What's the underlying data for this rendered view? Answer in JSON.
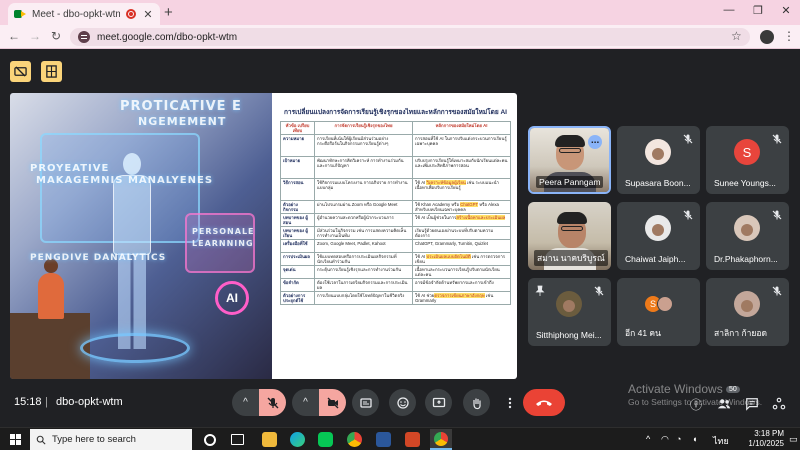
{
  "browser": {
    "tab_title": "Meet - dbo-opkt-wtm",
    "tab_close": "✕",
    "new_tab": "+",
    "url": "meet.google.com/dbo-opkt-wtm",
    "window_controls": [
      "—",
      "❐",
      "✕"
    ]
  },
  "slide": {
    "art_title": "PROTICATIVE E",
    "art_subtitle": "NGEMEMENT",
    "art_left_line1": "PROYEATIVE",
    "art_left_line2": "MAKAGEMNIS MANALYENES",
    "art_personal1": "PERSONALE",
    "art_personal2": "LEARNNING",
    "art_danalytics": "PENGDIVE DANALYTICS",
    "art_ai": "AI",
    "title": "การเปลี่ยนแปลงการจัดการเรียนรู้เชิงรุกของไทยและหลักการของสมัยใหม่โดย AI",
    "headers": [
      "หัวข้อ เปรียบเทียบ",
      "การจัดการเรียนรู้เชิงรุกของไทย",
      "หลักการของสมัยใหม่โดย AI"
    ],
    "rows": [
      {
        "aspect": "ความหมาย",
        "thai": "การเรียนที่เน้นให้ผู้เรียนมีส่วนร่วมอย่างกระตือรือร้นในกิจกรรมการเรียนรู้ต่างๆ",
        "ai": "การสอนที่ใช้ AI ในการปรับแต่งกระบวนการเรียนรู้เฉพาะบุคคล"
      },
      {
        "aspect": "เป้าหมาย",
        "thai": "พัฒนาทักษะการคิดวิเคราะห์ การทำงานร่วมกัน และการแก้ปัญหา",
        "ai": "ปรับปรุงการเรียนรู้ให้เหมาะสมกับนักเรียนแต่ละคน และเพิ่มประสิทธิภาพการสอน"
      },
      {
        "aspect": "วิธีการสอน",
        "thai": "ใช้กิจกรรมแบบโครงงาน การอภิปราย การทำงานแบบกลุ่ม",
        "ai_pre": "ใช้ AI ",
        "ai_hl": "วิเคราะห์ข้อมูลผู้เรียน",
        "ai_post": " เช่น ระบบแนะนำเนื้อหาเพื่อปรับการเรียนรู้"
      },
      {
        "aspect": "ตัวอย่าง กิจกรรม",
        "thai": "ผ่านโปรแกรมผ่าน Zoom หรือ Google Meet",
        "ai_pre": "ใช้ Khan Academy หรือ ",
        "ai_hl": "ChatGPT",
        "ai_post": " หรือ Alexa สำหรับบทเรียนเฉพาะบุคคล"
      },
      {
        "aspect": "บทบาทของ ผู้สอน",
        "thai": "ผู้อำนวยความสะดวกหรือผู้นำกระบวนการ",
        "ai_pre": "ใช้ AI เป็นผู้ช่วยในการ",
        "ai_hl": "สร้างเนื้อหาและประเมินผล",
        "ai_post": ""
      },
      {
        "aspect": "บทบาทของ ผู้เรียน",
        "thai": "มีส่วนร่วมในกิจกรรม เช่น การแสดงความคิดเห็น การทำงานเป็นทีม",
        "ai": "เรียนรู้ด้วยตนเองผ่านระบบที่ปรับตามความต้องการ"
      },
      {
        "aspect": "เครื่องมือที่ใช้",
        "thai": "Zoom, Google Meet, Padlet, Kahoot",
        "ai": "ChatGPT, Grammarly, Turnitin, Quizlet"
      },
      {
        "aspect": "การประเมินผล",
        "thai": "ใช้แบบทดสอบหรือการประเมินผลกิจกรรมที่นักเรียนทำร่วมกัน",
        "ai_pre": "ใช้ AI ",
        "ai_hl": "ประเมินผลแบบอัตโนมัติ",
        "ai_post": " เช่น การตรวจการเขียน"
      },
      {
        "aspect": "จุดเด่น",
        "thai": "กระตุ้นการเรียนรู้เชิงรุกและการทำงานร่วมกัน",
        "ai": "เนื้อหาและกระบวนการเรียนรู้ปรับตามนักเรียนแต่ละคน"
      },
      {
        "aspect": "ข้อจำกัด",
        "thai": "ต้องใช้เวลาในการเตรียมกิจกรรมและการประเมินผล",
        "ai": "อาจมีข้อจำกัดด้านทรัพยากรและการเข้าถึง"
      },
      {
        "aspect": "ตัวอย่างการ ประยุกต์ใช้",
        "thai": "การเรียนแบบกลุ่มโดยใช้โจทย์ปัญหาในชีวิตจริง",
        "ai_pre": "ใช้ AI ช่วย",
        "ai_hl": "ตรวจการเขียนภาษาอังกฤษ",
        "ai_post": " เช่น Grammarly"
      }
    ]
  },
  "participants": [
    {
      "name": "Peera Panngam",
      "type": "video",
      "active": true
    },
    {
      "name": "Supasara Boon...",
      "type": "avatar",
      "color": "#f3e6df"
    },
    {
      "name": "Sunee Youngs...",
      "type": "letter",
      "letter": "S",
      "color": "#e8453c"
    },
    {
      "name": "สมาน นาคบริบูรณ์",
      "type": "video2"
    },
    {
      "name": "Chaiwat Jaiph...",
      "type": "avatar",
      "color": "#e9e9e9"
    },
    {
      "name": "Dr.Phakaphorn...",
      "type": "avatar",
      "color": "#d9c7ba"
    },
    {
      "name": "Sitthiphong Mei...",
      "type": "avatar",
      "color": "#6b5c3e"
    },
    {
      "name": "อีก 41 คน",
      "type": "more",
      "letter": "S"
    },
    {
      "name": "สาลิกา ก้ายอด",
      "type": "avatar",
      "color": "#c3a79a"
    }
  ],
  "meeting": {
    "time": "15:18",
    "separator": "|",
    "code": "dbo-opkt-wtm",
    "participants_badge": "50",
    "watermark_title": "Activate Windows",
    "watermark_sub": "Go to Settings to activate Windows."
  },
  "taskbar": {
    "search_placeholder": "Type here to search",
    "lang": "ไทย",
    "time": "3:18 PM",
    "date": "1/10/2025",
    "tray_caret": "^"
  }
}
